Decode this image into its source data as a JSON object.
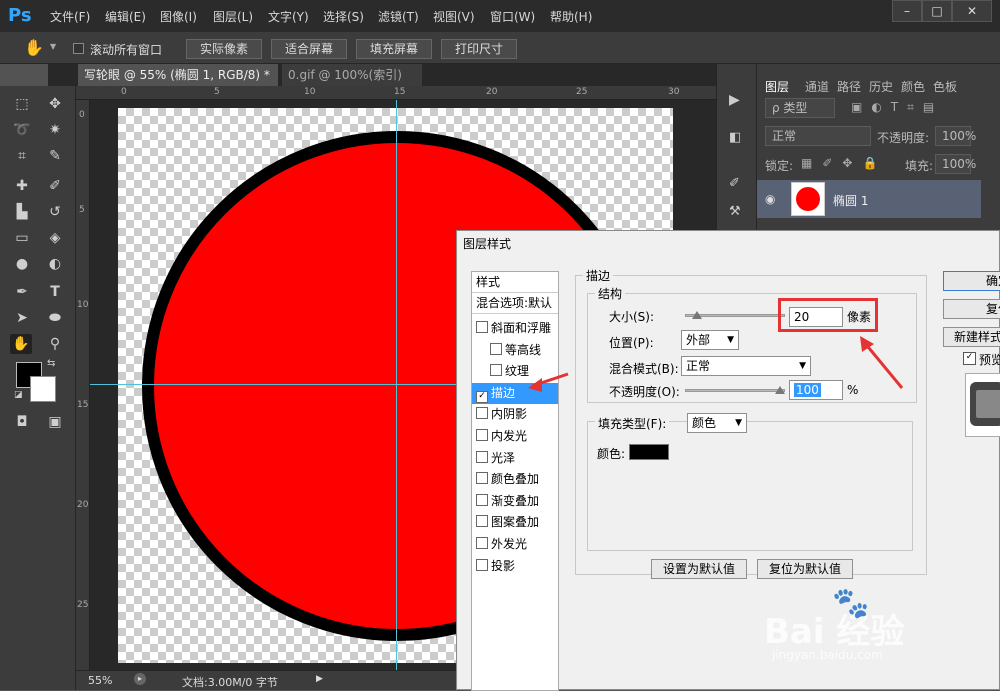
{
  "app": {
    "logo": "Ps",
    "menu": [
      "文件(F)",
      "编辑(E)",
      "图像(I)",
      "图层(L)",
      "文字(Y)",
      "选择(S)",
      "滤镜(T)",
      "视图(V)",
      "窗口(W)",
      "帮助(H)"
    ],
    "window_controls": [
      "–",
      "□",
      "✕"
    ]
  },
  "options_bar": {
    "scroll_all_label": "滚动所有窗口",
    "buttons": [
      "实际像素",
      "适合屏幕",
      "填充屏幕",
      "打印尺寸"
    ]
  },
  "tabs": [
    {
      "label": "写轮眼 @ 55% (椭圆 1, RGB/8) *",
      "close": "×",
      "active": true
    },
    {
      "label": "0.gif @ 100%(索引)",
      "close": "×",
      "active": false
    }
  ],
  "rulers": {
    "top": [
      "0",
      "5",
      "10",
      "15",
      "20",
      "25",
      "30"
    ],
    "left": [
      "0",
      "5",
      "10",
      "15",
      "20",
      "25"
    ]
  },
  "status": {
    "zoom": "55%",
    "doc": "文档:3.00M/0 字节"
  },
  "layers_panel": {
    "tabs": [
      "图层",
      "通道",
      "路径",
      "历史",
      "颜色",
      "色板"
    ],
    "filter_kind": "ρ 类型",
    "blend_mode": "正常",
    "opacity_label": "不透明度:",
    "opacity_value": "100%",
    "lock_label": "锁定:",
    "fill_label": "填充:",
    "fill_value": "100%",
    "layer_name": "椭圆 1"
  },
  "dialog": {
    "title": "图层样式",
    "styles_header": "样式",
    "blend_options": "混合选项:默认",
    "items": [
      {
        "label": "斜面和浮雕",
        "checked": false,
        "indent": false
      },
      {
        "label": "等高线",
        "checked": false,
        "indent": true
      },
      {
        "label": "纹理",
        "checked": false,
        "indent": true
      },
      {
        "label": "描边",
        "checked": true,
        "indent": false,
        "selected": true
      },
      {
        "label": "内阴影",
        "checked": false,
        "indent": false
      },
      {
        "label": "内发光",
        "checked": false,
        "indent": false
      },
      {
        "label": "光泽",
        "checked": false,
        "indent": false
      },
      {
        "label": "颜色叠加",
        "checked": false,
        "indent": false
      },
      {
        "label": "渐变叠加",
        "checked": false,
        "indent": false
      },
      {
        "label": "图案叠加",
        "checked": false,
        "indent": false
      },
      {
        "label": "外发光",
        "checked": false,
        "indent": false
      },
      {
        "label": "投影",
        "checked": false,
        "indent": false
      }
    ],
    "stroke_group": "描边",
    "structure_group": "结构",
    "size_label": "大小(S):",
    "size_value": "20",
    "size_unit": "像素",
    "position_label": "位置(P):",
    "position_value": "外部",
    "blend_label": "混合模式(B):",
    "blend_value": "正常",
    "opacity_label": "不透明度(O):",
    "opacity_value": "100",
    "opacity_unit": "%",
    "fill_type_label": "填充类型(F):",
    "fill_type_value": "颜色",
    "color_label": "颜色:",
    "stroke_color": "#000000",
    "set_default": "设置为默认值",
    "reset_default": "复位为默认值",
    "ok": "确定",
    "reset": "复位",
    "new_style": "新建样式...",
    "preview": "预览"
  },
  "watermark": {
    "brand": "Bai  经验",
    "url": "jingyan.baidu.com"
  },
  "colors": {
    "circle_fill": "#ff0000",
    "circle_stroke": "#000000",
    "highlight": "#e53333",
    "selected_item": "#3399ff"
  }
}
